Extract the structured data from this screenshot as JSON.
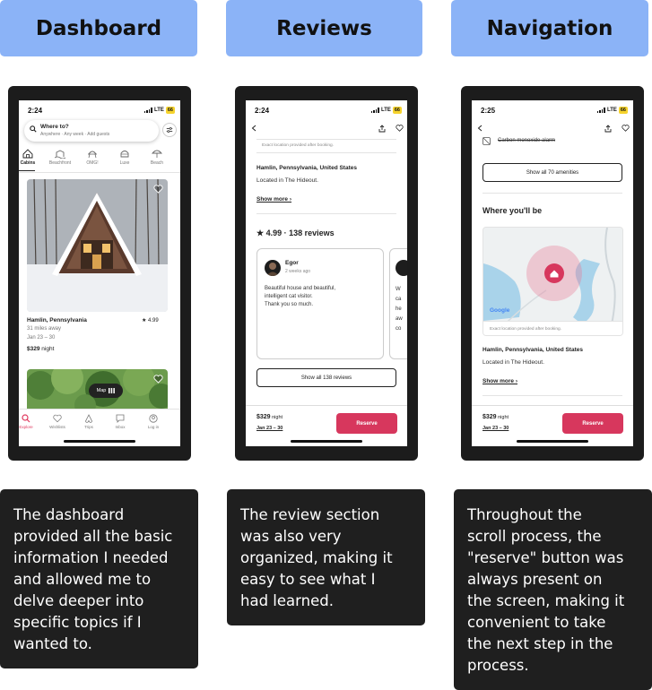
{
  "headers": [
    "Dashboard",
    "Reviews",
    "Navigation"
  ],
  "captions": [
    [
      "The dashboard",
      "provided all the basic",
      "information I needed",
      "and allowed me to",
      "delve deeper into",
      "specific topics if I",
      "wanted to."
    ],
    [
      "The review section",
      "was also very",
      "organized, making it",
      "easy to see what I",
      "had learned."
    ],
    [
      "Throughout the",
      "scroll process, the",
      "\"reserve\" button was",
      "always present on",
      "the screen, making it",
      "convenient to take",
      "the next step in the",
      "process."
    ]
  ],
  "status": {
    "time1": "2:24",
    "time2": "2:24",
    "time3": "2:25",
    "network": "LTE",
    "battery": "66"
  },
  "dashboard": {
    "search_title": "Where to?",
    "search_sub": "Anywhere · Any week · Add guests",
    "categories": [
      "Cabins",
      "Beachfront",
      "OMG!",
      "Luxe",
      "Beach"
    ],
    "listing": {
      "title": "Hamlin, Pennsylvania",
      "rating": "★ 4.99",
      "distance": "31 miles away",
      "dates": "Jan 23 – 30",
      "price": "$329",
      "price_unit": " night"
    },
    "map_label": "Map",
    "tabs": [
      "Explore",
      "Wishlists",
      "Trips",
      "Inbox",
      "Log in"
    ]
  },
  "reviews": {
    "exact_note": "Exact location provided after booking.",
    "location": "Hamlin, Pennsylvania, United States",
    "located_in": "Located in The Hideout.",
    "show_more": "Show more ›",
    "summary": "★ 4.99 · 138 reviews",
    "reviewer": "Egor",
    "review_date": "2 weeks ago",
    "review_lines": [
      "Beautiful house and beautiful,",
      "intelligent cat visitor.",
      "Thank you so much."
    ],
    "peek_lines": [
      "W",
      "ca",
      "he",
      "aw",
      "co"
    ],
    "show_all": "Show all 138 reviews"
  },
  "navigation": {
    "amenity": "Carbon monoxide alarm",
    "show_all": "Show all 70 amenities",
    "where_title": "Where you'll be",
    "map_google": "Google",
    "exact_note": "Exact location provided after booking.",
    "location": "Hamlin, Pennsylvania, United States",
    "located_in": "Located in The Hideout.",
    "show_more": "Show more ›"
  },
  "footer": {
    "price": "$329",
    "price_unit": " night",
    "dates": "Jan 23 – 30",
    "reserve": "Reserve"
  },
  "colors": {
    "header_bg": "#8bb3f7",
    "caption_bg": "#1f1f1f",
    "accent": "#d7375d"
  }
}
